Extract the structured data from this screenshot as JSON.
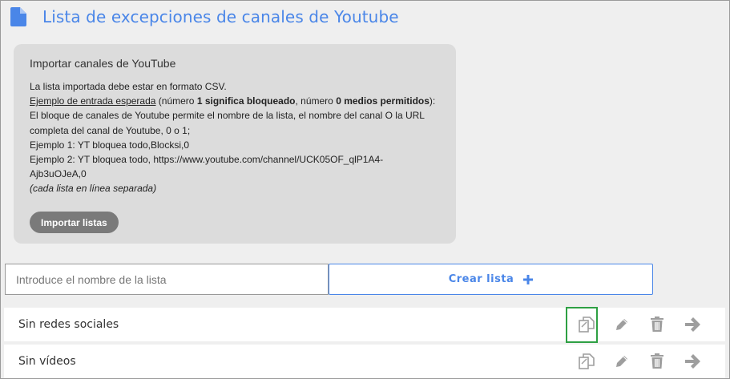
{
  "header": {
    "title": "Lista de excepciones de canales de Youtube",
    "icon": "document-icon"
  },
  "import_card": {
    "title": "Importar canales de YouTube",
    "line1": "La lista importada debe estar en formato CSV.",
    "example_link": "Ejemplo de entrada esperada",
    "example_open": " (número ",
    "bold1": "1 significa bloqueado",
    "example_mid": ", número ",
    "bold2": "0 medios permitidos",
    "example_close": "):",
    "line3": "El bloque de canales de Youtube permite el nombre de la lista, el nombre del canal O la URL completa del canal de Youtube, 0 o 1;",
    "line4": "Ejemplo 1: YT bloquea todo,Blocksi,0",
    "line5": "Ejemplo 2: YT bloquea todo, https://www.youtube.com/channel/UCK05OF_qlP1A4-Ajb3uOJeA,0",
    "note": "(cada lista en línea separada)",
    "import_button": "Importar listas"
  },
  "new_list": {
    "placeholder": "Introduce el nombre de la lista",
    "create_button": "Crear lista"
  },
  "lists": [
    {
      "name": "Sin redes sociales"
    },
    {
      "name": "Sin vídeos"
    }
  ],
  "colors": {
    "accent": "#4a86e8",
    "icon_gray": "#9e9e9e",
    "focus_green": "#2ea043",
    "card_bg": "#dcdcdc",
    "button_gray": "#7a7a7a"
  }
}
